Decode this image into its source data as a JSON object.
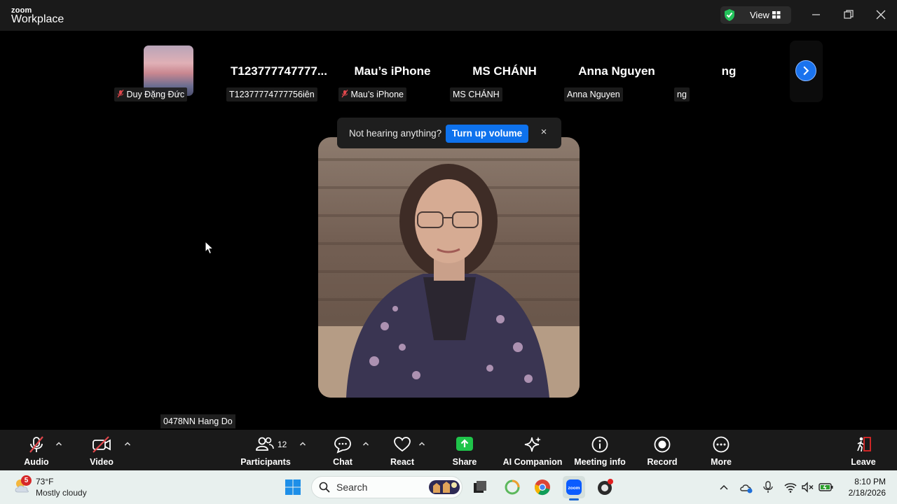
{
  "app": {
    "brand_small": "zoom",
    "brand_big": "Workplace"
  },
  "titlebar": {
    "view_label": "View"
  },
  "gallery": {
    "tiles": [
      {
        "name": "",
        "label": "Duy Đặng Đức",
        "muted": true
      },
      {
        "name": "T123777747777...",
        "label": "T12377774777756iên",
        "muted": false
      },
      {
        "name": "Mau’s iPhone",
        "label": "Mau’s iPhone",
        "muted": true
      },
      {
        "name": "MS CHÁNH",
        "label": "MS CHÁNH",
        "muted": false
      },
      {
        "name": "Anna Nguyen",
        "label": "Anna Nguyen",
        "muted": false
      },
      {
        "name": "ng",
        "label": "ng",
        "muted": false
      }
    ]
  },
  "toast": {
    "text": "Not hearing anything?",
    "button": "Turn up volume",
    "close": "×"
  },
  "speaker": {
    "label": "0478NN Hang Do"
  },
  "toolbar": {
    "audio": "Audio",
    "video": "Video",
    "participants": "Participants",
    "participants_count": "12",
    "chat": "Chat",
    "react": "React",
    "share": "Share",
    "ai_companion": "AI Companion",
    "meeting_info": "Meeting info",
    "record": "Record",
    "more": "More",
    "leave": "Leave"
  },
  "taskbar": {
    "weather_badge": "5",
    "weather_temp": "73°F",
    "weather_desc": "Mostly cloudy",
    "search_label": "Search",
    "time": "8:10 PM",
    "date": "2/18/2026"
  },
  "colors": {
    "accent": "#0e72ed",
    "share_green": "#1fc44a",
    "leave_red": "#e02828",
    "mute_red": "#e0474c"
  }
}
